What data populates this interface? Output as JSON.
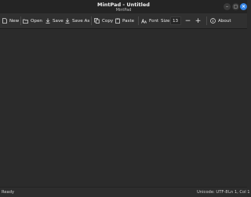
{
  "window": {
    "title": "MintPad - Untitled",
    "subtitle": "MintPad"
  },
  "toolbar": {
    "new_label": "New",
    "open_label": "Open",
    "save_label": "Save",
    "save_as_label": "Save As",
    "copy_label": "Copy",
    "paste_label": "Paste",
    "font_label": "Font",
    "size_label": "Size",
    "size_value": "13",
    "decrease_label": "−",
    "increase_label": "+",
    "about_label": "About"
  },
  "editor": {
    "content": ""
  },
  "statusbar": {
    "message": "Ready",
    "encoding": "Unicode: UTF-8",
    "position": "Ln 1, Col 1"
  },
  "colors": {
    "accent": "#3584e4",
    "background": "#2b2b2b"
  },
  "icons": [
    "new-icon",
    "open-icon",
    "save-icon",
    "save-as-icon",
    "copy-icon",
    "paste-icon",
    "font-icon",
    "info-icon"
  ]
}
